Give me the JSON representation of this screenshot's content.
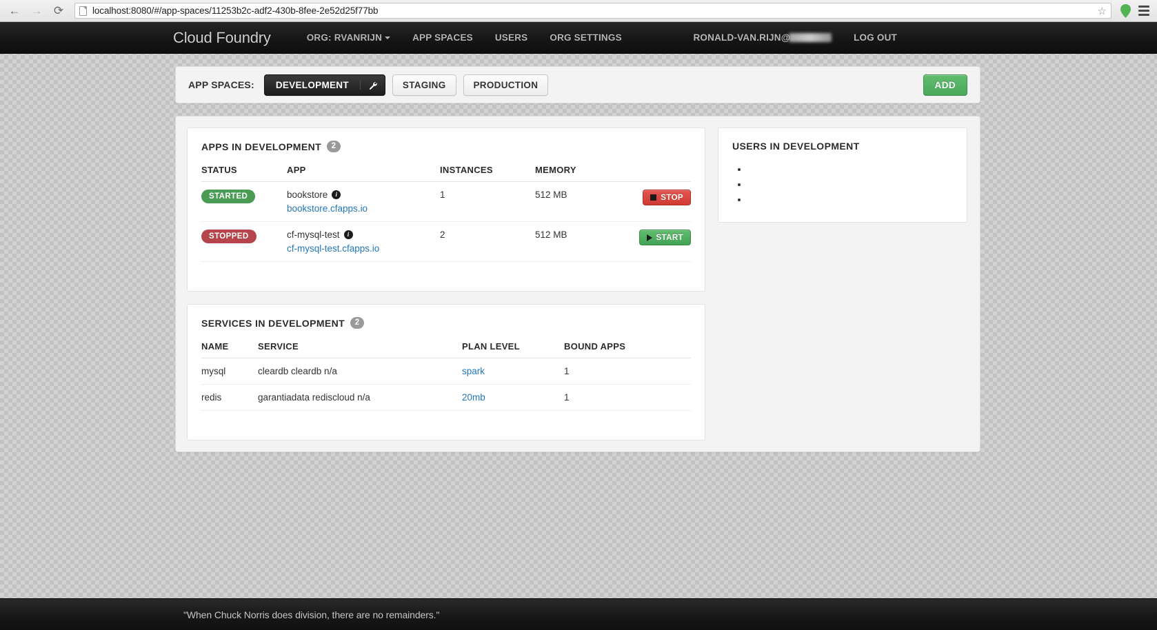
{
  "browser": {
    "back_icon": "←",
    "forward_icon": "→",
    "reload_icon": "⟳",
    "url": "localhost:8080/#/app-spaces/11253b2c-adf2-430b-8fee-2e52d25f77bb",
    "url_host": "localhost:8080",
    "url_path": "/#/app-spaces/11253b2c-adf2-430b-8fee-2e52d25f77bb",
    "star_icon": "☆",
    "extension_icon": "location-pin",
    "menu_icon": "hamburger-menu"
  },
  "navbar": {
    "brand": "Cloud Foundry",
    "links": [
      {
        "label": "ORG: RVANRIJN",
        "has_caret": true
      },
      {
        "label": "APP SPACES",
        "has_caret": false
      },
      {
        "label": "USERS",
        "has_caret": false
      },
      {
        "label": "ORG SETTINGS",
        "has_caret": false
      }
    ],
    "user": "RONALD-VAN.RIJN@",
    "logout": "LOG OUT"
  },
  "spaces_bar": {
    "label": "APP SPACES:",
    "tabs": [
      {
        "label": "DEVELOPMENT",
        "active": true,
        "tool_icon": "wrench-icon"
      },
      {
        "label": "STAGING",
        "active": false
      },
      {
        "label": "PRODUCTION",
        "active": false
      }
    ],
    "add_label": "ADD"
  },
  "apps_card": {
    "title": "APPS IN DEVELOPMENT",
    "count": "2",
    "columns": [
      "STATUS",
      "APP",
      "INSTANCES",
      "MEMORY",
      ""
    ],
    "rows": [
      {
        "status": "STARTED",
        "status_kind": "started",
        "app": "bookstore",
        "url": "bookstore.cfapps.io",
        "instances": "1",
        "memory": "512 MB",
        "action": "STOP",
        "action_kind": "stop"
      },
      {
        "status": "STOPPED",
        "status_kind": "stopped",
        "app": "cf-mysql-test",
        "url": "cf-mysql-test.cfapps.io",
        "instances": "2",
        "memory": "512 MB",
        "action": "START",
        "action_kind": "start"
      }
    ]
  },
  "services_card": {
    "title": "SERVICES IN DEVELOPMENT",
    "count": "2",
    "columns": [
      "NAME",
      "SERVICE",
      "PLAN LEVEL",
      "BOUND APPS"
    ],
    "rows": [
      {
        "name": "mysql",
        "service": "cleardb cleardb n/a",
        "plan": "spark",
        "bound": "1"
      },
      {
        "name": "redis",
        "service": "garantiadata rediscloud n/a",
        "plan": "20mb",
        "bound": "1"
      }
    ]
  },
  "users_card": {
    "title": "USERS IN DEVELOPMENT",
    "items": [
      "",
      "",
      ""
    ]
  },
  "footer": {
    "quote": "\"When Chuck Norris does division, there are no remainders.\""
  },
  "colors": {
    "navbar_bg": "#161616",
    "accent_green": "#4aa85c",
    "accent_red": "#cf3a33",
    "link_blue": "#2277bb",
    "badge_grey": "#9a9a9a"
  }
}
